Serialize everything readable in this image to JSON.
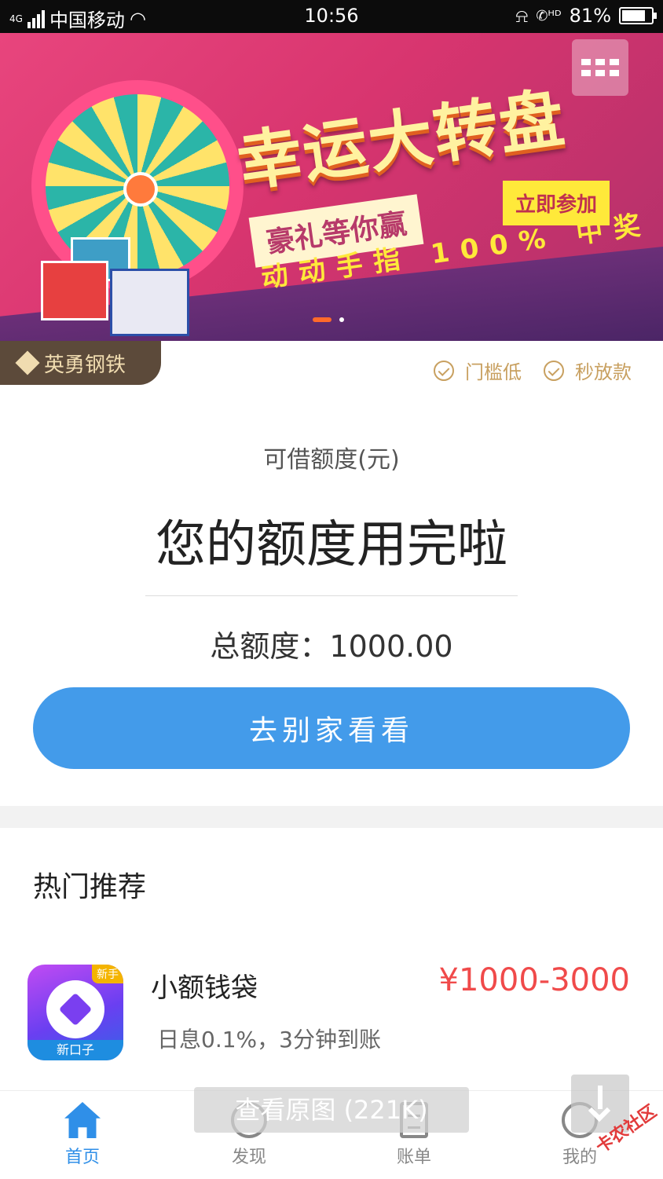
{
  "status_bar": {
    "network": "4G",
    "carrier": "中国移动",
    "time": "10:56",
    "battery": "81%",
    "battery_level": 0.81,
    "icons": [
      "signal-icon",
      "wifi-icon",
      "mute-bell-icon",
      "hd-call-icon",
      "battery-icon"
    ]
  },
  "banner": {
    "title": "幸运大转盘",
    "subtitle": "豪礼等你赢",
    "join_label": "立即参加",
    "slogan": "动动手指 100% 中奖",
    "colors": {
      "background": "#d8356f",
      "accent": "#ffe93a"
    },
    "carousel_active_index": 0,
    "carousel_count": 2
  },
  "vip": {
    "level": "英勇钢铁"
  },
  "features": [
    "门槛低",
    "秒放款"
  ],
  "credit": {
    "label": "可借额度(元)",
    "status": "您的额度用完啦",
    "total": "总额度：1000.00",
    "button": "去别家看看"
  },
  "hot": {
    "title": "热门推荐",
    "items": [
      {
        "name": "小额钱袋",
        "desc": "日息0.1%，3分钟到账",
        "range": "¥1000-3000",
        "icon_tag": "新手",
        "icon_brand": "新口子"
      }
    ]
  },
  "overlay": {
    "view_original": "查看原图 (221K)"
  },
  "tabbar": {
    "items": [
      {
        "label": "首页",
        "icon": "home-icon",
        "active": true
      },
      {
        "label": "发现",
        "icon": "planet-icon",
        "active": false
      },
      {
        "label": "账单",
        "icon": "bill-icon",
        "active": false
      },
      {
        "label": "我的",
        "icon": "smiley-icon",
        "active": false
      }
    ]
  },
  "watermark": "卡农社区",
  "colors": {
    "primary": "#439bea",
    "price": "#f04a4a",
    "gold": "#c8a060"
  }
}
